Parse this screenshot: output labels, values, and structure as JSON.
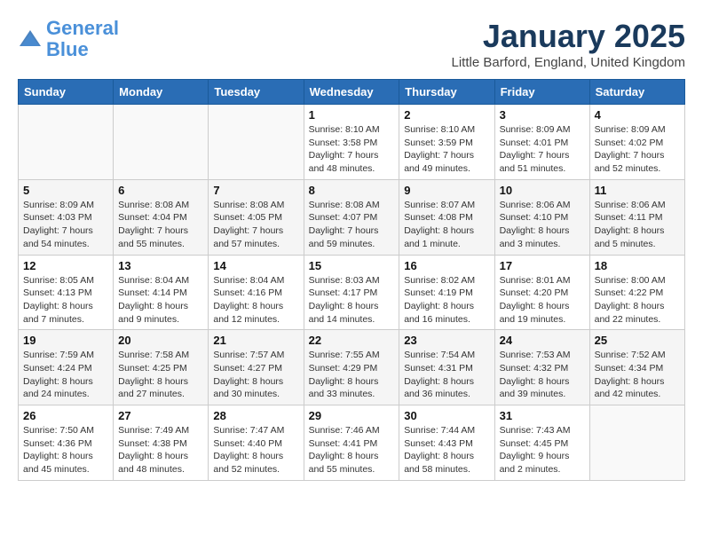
{
  "logo": {
    "line1": "General",
    "line2": "Blue"
  },
  "title": "January 2025",
  "subtitle": "Little Barford, England, United Kingdom",
  "days_of_week": [
    "Sunday",
    "Monday",
    "Tuesday",
    "Wednesday",
    "Thursday",
    "Friday",
    "Saturday"
  ],
  "weeks": [
    [
      {
        "num": "",
        "info": ""
      },
      {
        "num": "",
        "info": ""
      },
      {
        "num": "",
        "info": ""
      },
      {
        "num": "1",
        "info": "Sunrise: 8:10 AM\nSunset: 3:58 PM\nDaylight: 7 hours\nand 48 minutes."
      },
      {
        "num": "2",
        "info": "Sunrise: 8:10 AM\nSunset: 3:59 PM\nDaylight: 7 hours\nand 49 minutes."
      },
      {
        "num": "3",
        "info": "Sunrise: 8:09 AM\nSunset: 4:01 PM\nDaylight: 7 hours\nand 51 minutes."
      },
      {
        "num": "4",
        "info": "Sunrise: 8:09 AM\nSunset: 4:02 PM\nDaylight: 7 hours\nand 52 minutes."
      }
    ],
    [
      {
        "num": "5",
        "info": "Sunrise: 8:09 AM\nSunset: 4:03 PM\nDaylight: 7 hours\nand 54 minutes."
      },
      {
        "num": "6",
        "info": "Sunrise: 8:08 AM\nSunset: 4:04 PM\nDaylight: 7 hours\nand 55 minutes."
      },
      {
        "num": "7",
        "info": "Sunrise: 8:08 AM\nSunset: 4:05 PM\nDaylight: 7 hours\nand 57 minutes."
      },
      {
        "num": "8",
        "info": "Sunrise: 8:08 AM\nSunset: 4:07 PM\nDaylight: 7 hours\nand 59 minutes."
      },
      {
        "num": "9",
        "info": "Sunrise: 8:07 AM\nSunset: 4:08 PM\nDaylight: 8 hours\nand 1 minute."
      },
      {
        "num": "10",
        "info": "Sunrise: 8:06 AM\nSunset: 4:10 PM\nDaylight: 8 hours\nand 3 minutes."
      },
      {
        "num": "11",
        "info": "Sunrise: 8:06 AM\nSunset: 4:11 PM\nDaylight: 8 hours\nand 5 minutes."
      }
    ],
    [
      {
        "num": "12",
        "info": "Sunrise: 8:05 AM\nSunset: 4:13 PM\nDaylight: 8 hours\nand 7 minutes."
      },
      {
        "num": "13",
        "info": "Sunrise: 8:04 AM\nSunset: 4:14 PM\nDaylight: 8 hours\nand 9 minutes."
      },
      {
        "num": "14",
        "info": "Sunrise: 8:04 AM\nSunset: 4:16 PM\nDaylight: 8 hours\nand 12 minutes."
      },
      {
        "num": "15",
        "info": "Sunrise: 8:03 AM\nSunset: 4:17 PM\nDaylight: 8 hours\nand 14 minutes."
      },
      {
        "num": "16",
        "info": "Sunrise: 8:02 AM\nSunset: 4:19 PM\nDaylight: 8 hours\nand 16 minutes."
      },
      {
        "num": "17",
        "info": "Sunrise: 8:01 AM\nSunset: 4:20 PM\nDaylight: 8 hours\nand 19 minutes."
      },
      {
        "num": "18",
        "info": "Sunrise: 8:00 AM\nSunset: 4:22 PM\nDaylight: 8 hours\nand 22 minutes."
      }
    ],
    [
      {
        "num": "19",
        "info": "Sunrise: 7:59 AM\nSunset: 4:24 PM\nDaylight: 8 hours\nand 24 minutes."
      },
      {
        "num": "20",
        "info": "Sunrise: 7:58 AM\nSunset: 4:25 PM\nDaylight: 8 hours\nand 27 minutes."
      },
      {
        "num": "21",
        "info": "Sunrise: 7:57 AM\nSunset: 4:27 PM\nDaylight: 8 hours\nand 30 minutes."
      },
      {
        "num": "22",
        "info": "Sunrise: 7:55 AM\nSunset: 4:29 PM\nDaylight: 8 hours\nand 33 minutes."
      },
      {
        "num": "23",
        "info": "Sunrise: 7:54 AM\nSunset: 4:31 PM\nDaylight: 8 hours\nand 36 minutes."
      },
      {
        "num": "24",
        "info": "Sunrise: 7:53 AM\nSunset: 4:32 PM\nDaylight: 8 hours\nand 39 minutes."
      },
      {
        "num": "25",
        "info": "Sunrise: 7:52 AM\nSunset: 4:34 PM\nDaylight: 8 hours\nand 42 minutes."
      }
    ],
    [
      {
        "num": "26",
        "info": "Sunrise: 7:50 AM\nSunset: 4:36 PM\nDaylight: 8 hours\nand 45 minutes."
      },
      {
        "num": "27",
        "info": "Sunrise: 7:49 AM\nSunset: 4:38 PM\nDaylight: 8 hours\nand 48 minutes."
      },
      {
        "num": "28",
        "info": "Sunrise: 7:47 AM\nSunset: 4:40 PM\nDaylight: 8 hours\nand 52 minutes."
      },
      {
        "num": "29",
        "info": "Sunrise: 7:46 AM\nSunset: 4:41 PM\nDaylight: 8 hours\nand 55 minutes."
      },
      {
        "num": "30",
        "info": "Sunrise: 7:44 AM\nSunset: 4:43 PM\nDaylight: 8 hours\nand 58 minutes."
      },
      {
        "num": "31",
        "info": "Sunrise: 7:43 AM\nSunset: 4:45 PM\nDaylight: 9 hours\nand 2 minutes."
      },
      {
        "num": "",
        "info": ""
      }
    ]
  ]
}
